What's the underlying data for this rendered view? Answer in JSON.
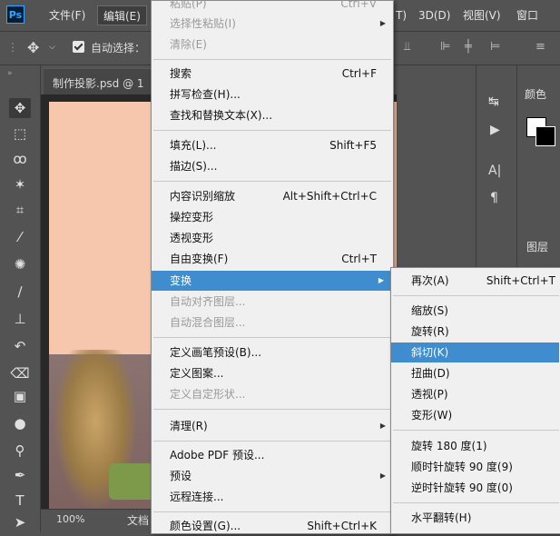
{
  "menubar": {
    "logo": "Ps",
    "items": [
      {
        "label": "文件(F)"
      },
      {
        "label": "编辑(E)"
      },
      {
        "label": "T)"
      },
      {
        "label": "3D(D)"
      },
      {
        "label": "视图(V)"
      },
      {
        "label": "窗口(W)"
      }
    ]
  },
  "options": {
    "auto_select_label": "自动选择："
  },
  "document": {
    "tab_label": "制作投影.psd @ 1",
    "zoom": "100%",
    "status_text": "文档"
  },
  "panels": {
    "color_tab": "颜色",
    "layers_tab": "图层"
  },
  "edit_menu": {
    "items": [
      {
        "label": "粘贴(P)",
        "shortcut": "Ctrl+V"
      },
      {
        "label": "选择性粘贴(I)",
        "shortcut": ""
      },
      {
        "label": "清除(E)",
        "shortcut": ""
      },
      {
        "label": "搜索",
        "shortcut": "Ctrl+F"
      },
      {
        "label": "拼写检查(H)...",
        "shortcut": ""
      },
      {
        "label": "查找和替换文本(X)...",
        "shortcut": ""
      },
      {
        "label": "填充(L)...",
        "shortcut": "Shift+F5"
      },
      {
        "label": "描边(S)...",
        "shortcut": ""
      },
      {
        "label": "内容识别缩放",
        "shortcut": "Alt+Shift+Ctrl+C"
      },
      {
        "label": "操控变形",
        "shortcut": ""
      },
      {
        "label": "透视变形",
        "shortcut": ""
      },
      {
        "label": "自由变换(F)",
        "shortcut": "Ctrl+T"
      },
      {
        "label": "变换",
        "shortcut": ""
      },
      {
        "label": "自动对齐图层...",
        "shortcut": ""
      },
      {
        "label": "自动混合图层...",
        "shortcut": ""
      },
      {
        "label": "定义画笔预设(B)...",
        "shortcut": ""
      },
      {
        "label": "定义图案...",
        "shortcut": ""
      },
      {
        "label": "定义自定形状...",
        "shortcut": ""
      },
      {
        "label": "清理(R)",
        "shortcut": ""
      },
      {
        "label": "Adobe PDF 预设...",
        "shortcut": ""
      },
      {
        "label": "预设",
        "shortcut": ""
      },
      {
        "label": "远程连接...",
        "shortcut": ""
      },
      {
        "label": "颜色设置(G)...",
        "shortcut": "Shift+Ctrl+K"
      }
    ]
  },
  "transform_submenu": {
    "items": [
      {
        "label": "再次(A)",
        "shortcut": "Shift+Ctrl+T"
      },
      {
        "label": "缩放(S)"
      },
      {
        "label": "旋转(R)"
      },
      {
        "label": "斜切(K)"
      },
      {
        "label": "扭曲(D)"
      },
      {
        "label": "透视(P)"
      },
      {
        "label": "变形(W)"
      },
      {
        "label": "旋转 180 度(1)"
      },
      {
        "label": "顺时针旋转 90 度(9)"
      },
      {
        "label": "逆时针旋转 90 度(0)"
      },
      {
        "label": "水平翻转(H)"
      }
    ]
  }
}
